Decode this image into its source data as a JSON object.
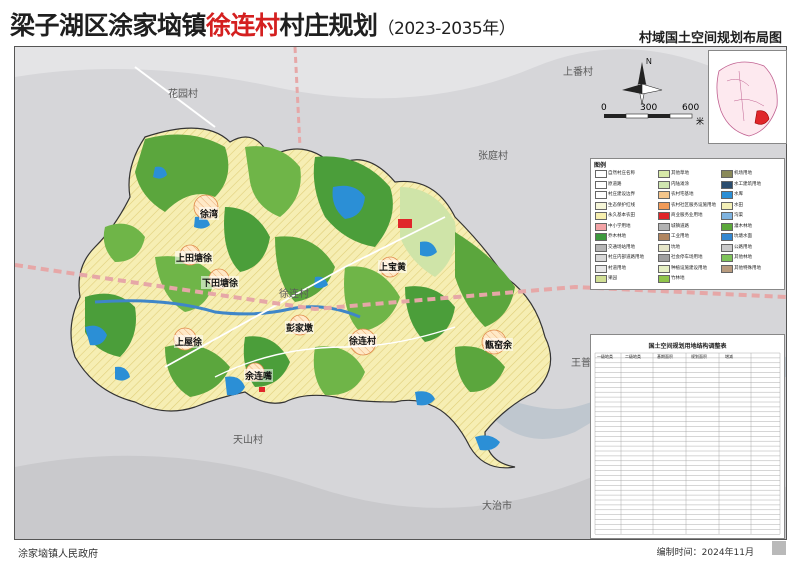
{
  "title": {
    "prefix": "梁子湖区涂家垴镇",
    "village": "徐连村",
    "suffix": "村庄规划",
    "years": "（2023-2035年）"
  },
  "subtitle": "村域国土空间规划布局图",
  "scale_bar": {
    "north": "N",
    "ticks": [
      "0",
      "300",
      "600"
    ],
    "unit": "米"
  },
  "village_labels": [
    "上番村",
    "花园村",
    "张庭村",
    "王普村",
    "徐连村",
    "天山村",
    "大治市"
  ],
  "place_labels": [
    "徐湾",
    "上田塘徐",
    "下田塘徐",
    "上屋徐",
    "彭家墩",
    "徐连村",
    "上宝黄",
    "甑窑余",
    "余连嘴"
  ],
  "legend": {
    "title": "图例",
    "items": [
      {
        "label": "自然村庄名称",
        "color": "#ffffff"
      },
      {
        "label": "其他草地",
        "color": "#d7e9a8"
      },
      {
        "label": "机场用地",
        "color": "#8a8a5a"
      },
      {
        "label": "原道路",
        "color": "#ffffff"
      },
      {
        "label": "内陆滩涂",
        "color": "#cfe6b0"
      },
      {
        "label": "水工建筑用地",
        "color": "#2b4d6e"
      },
      {
        "label": "村庄建设边界",
        "color": "#ffffff"
      },
      {
        "label": "农村宅基地",
        "color": "#f4c58a"
      },
      {
        "label": "水库",
        "color": "#2b8fd6"
      },
      {
        "label": "生态保护红线",
        "color": "#f6f6d8"
      },
      {
        "label": "农村社区服务设施用地",
        "color": "#f19a57"
      },
      {
        "label": "水田",
        "color": "#f3efb7"
      },
      {
        "label": "永久基本农田",
        "color": "#f7efae"
      },
      {
        "label": "商业服务业用地",
        "color": "#e0262a"
      },
      {
        "label": "沟渠",
        "color": "#7fb3e0"
      },
      {
        "label": "中小学用地",
        "color": "#f3a3a6"
      },
      {
        "label": "城镇道路",
        "color": "#b3b3b3"
      },
      {
        "label": "灌木林地",
        "color": "#5ca83b"
      },
      {
        "label": "乔木林地",
        "color": "#3d9a3e"
      },
      {
        "label": "工业用地",
        "color": "#b0855f"
      },
      {
        "label": "坑塘水面",
        "color": "#3387d0"
      },
      {
        "label": "交通场站用地",
        "color": "#b6b6b6"
      },
      {
        "label": "坑地",
        "color": "#e6e6c8"
      },
      {
        "label": "公路用地",
        "color": "#c9c9c9"
      },
      {
        "label": "村庄内部道路用地",
        "color": "#d9d9d9"
      },
      {
        "label": "社会停车场用地",
        "color": "#a0a0a0"
      },
      {
        "label": "其他林地",
        "color": "#7ec35a"
      },
      {
        "label": "村道用地",
        "color": "#e8e8e8"
      },
      {
        "label": "种植设施建设用地",
        "color": "#e6f0c4"
      },
      {
        "label": "其他特殊用地",
        "color": "#b89b7e"
      },
      {
        "label": "果园",
        "color": "#d1df95"
      },
      {
        "label": "竹林地",
        "color": "#8fc44a"
      }
    ]
  },
  "table": {
    "title": "国土空间规划用地结构调整表",
    "headers": [
      "一级地类",
      "二级地类",
      "基期面积",
      "规划面积",
      "增减"
    ]
  },
  "footer": {
    "org": "涂家垴镇人民政府",
    "date": "编制时间：2024年11月"
  },
  "colors": {
    "forest": "#3d9a3e",
    "forest_light": "#7ec35a",
    "farmland": "#f5ecb0",
    "water": "#2b8fd6",
    "residential": "#f4c58a",
    "commercial": "#e0262a",
    "background": "#cfcfd2",
    "title_accent": "#d42020"
  }
}
